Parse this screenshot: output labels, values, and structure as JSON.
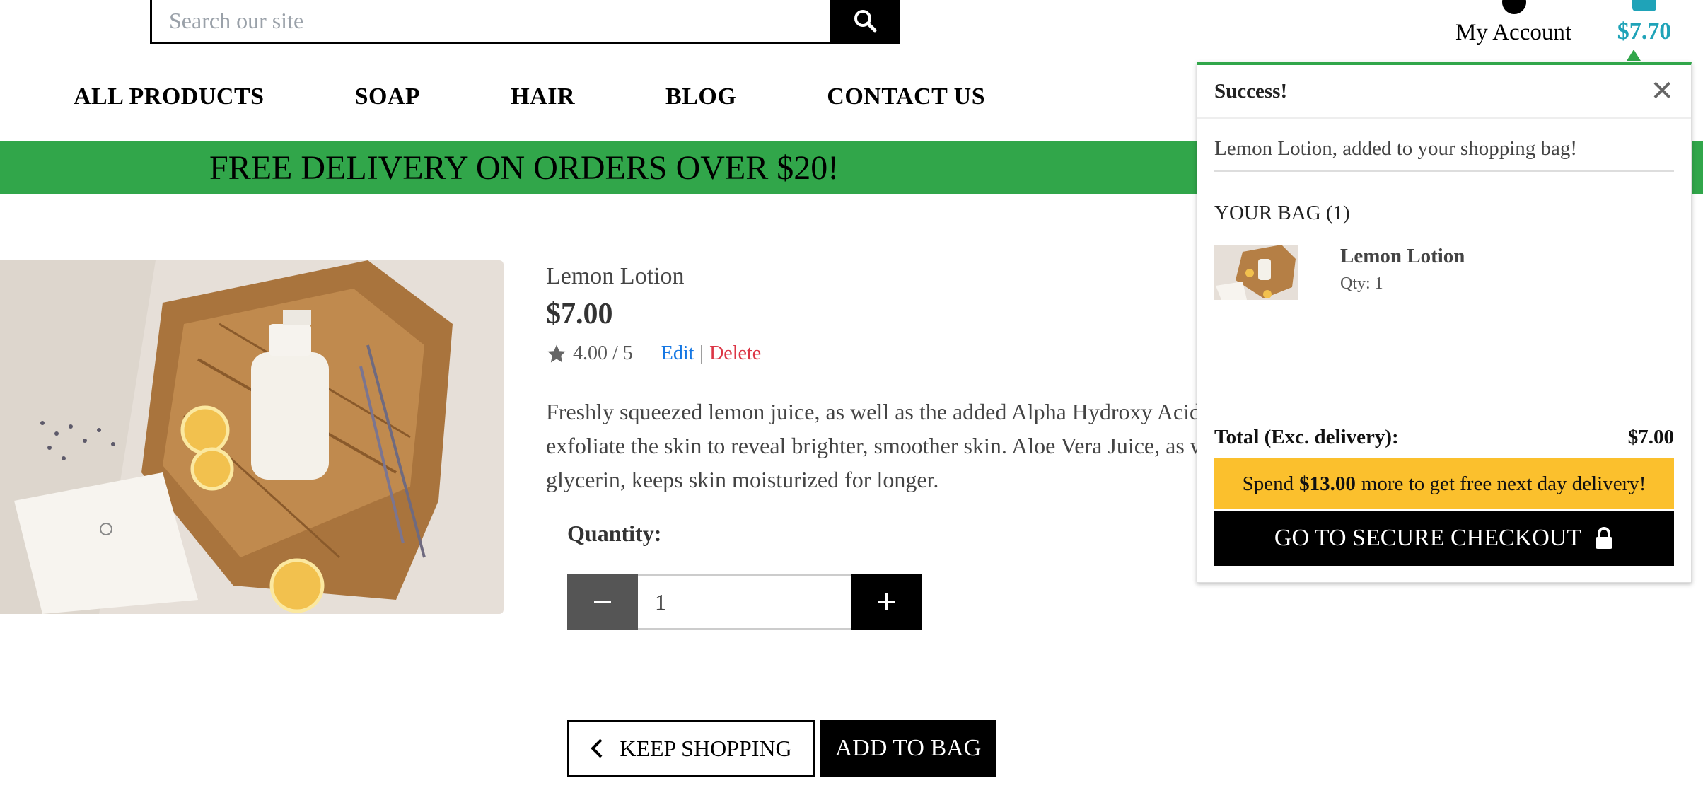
{
  "header": {
    "search_placeholder": "Search our site",
    "account_label": "My Account",
    "bag_total": "$7.70",
    "icons": [
      "search-icon",
      "account-icon",
      "bag-icon"
    ]
  },
  "nav": {
    "items": [
      "ALL PRODUCTS",
      "SOAP",
      "HAIR",
      "BLOG",
      "CONTACT US"
    ]
  },
  "promo": {
    "text": "FREE DELIVERY ON ORDERS OVER $20!",
    "color": "#31a64a"
  },
  "product": {
    "name": "Lemon Lotion",
    "price": "$7.00",
    "rating": "4.00 / 5",
    "edit_label": "Edit",
    "separator": "|",
    "delete_label": "Delete",
    "description": "Freshly squeezed lemon juice, as well as the added Alpha Hydroxy Acid\nexfoliate the skin to reveal brighter, smoother skin. Aloe Vera Juice, as w\nglycerin, keeps skin moisturized for longer.",
    "quantity_label": "Quantity:",
    "quantity_value": "1",
    "keep_shopping_label": "KEEP SHOPPING",
    "add_to_bag_label": "ADD TO BAG"
  },
  "toast": {
    "title": "Success!",
    "close_glyph": "✕",
    "message": "Lemon Lotion, added to your shopping bag!",
    "bag_heading": "YOUR BAG (1)",
    "item_name": "Lemon Lotion",
    "item_qty": "Qty: 1",
    "total_label": "Total (Exc. delivery):",
    "total_value": "$7.00",
    "delivery_prefix": "Spend",
    "delivery_amount": "$13.00",
    "delivery_suffix": "more to get free next day delivery!",
    "checkout_label": "GO TO SECURE CHECKOUT",
    "accent_color": "#31a64a",
    "delivery_color": "#fbc02d"
  },
  "colors": {
    "brand_teal": "#1fa3b8",
    "link_blue": "#1577e3",
    "delete_red": "#dc3545"
  }
}
